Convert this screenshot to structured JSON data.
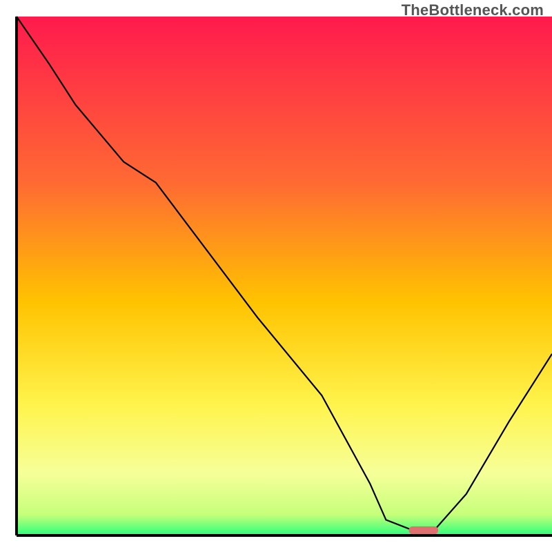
{
  "watermark": "TheBottleneck.com",
  "chart_data": {
    "type": "line",
    "title": "",
    "xlabel": "",
    "ylabel": "",
    "xlim": [
      0,
      100
    ],
    "ylim": [
      0,
      100
    ],
    "grid": false,
    "legend": false,
    "background_gradient_stops": [
      {
        "offset": 0,
        "color": "#ff1a4d"
      },
      {
        "offset": 32,
        "color": "#ff6a33"
      },
      {
        "offset": 55,
        "color": "#ffc300"
      },
      {
        "offset": 75,
        "color": "#fff44d"
      },
      {
        "offset": 88,
        "color": "#f6ff99"
      },
      {
        "offset": 96,
        "color": "#c6ff7a"
      },
      {
        "offset": 100,
        "color": "#2bff7a"
      }
    ],
    "series": [
      {
        "name": "bottleneck-curve",
        "color": "#000000",
        "x": [
          0,
          6,
          11,
          20,
          26,
          45,
          57,
          66,
          69,
          74,
          78,
          84,
          92,
          100
        ],
        "values": [
          100,
          91,
          83,
          72,
          68,
          42,
          27,
          10,
          3,
          1,
          1,
          8,
          22,
          35
        ]
      }
    ],
    "marker": {
      "name": "optimal-point",
      "x": 76,
      "y": 1,
      "width_pct": 5.5,
      "height_pct": 1.5,
      "color": "#e07070"
    },
    "axes": {
      "left": {
        "x": 3,
        "y0": 3,
        "y1": 97
      },
      "bottom": {
        "y": 97,
        "x0": 3,
        "x1": 100
      }
    }
  }
}
